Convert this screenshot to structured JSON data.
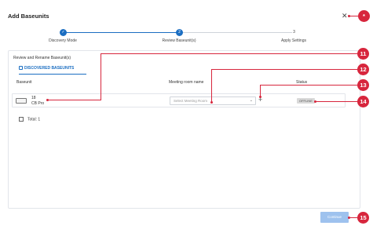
{
  "dialog": {
    "title": "Add Baseunits",
    "close_label": "✕"
  },
  "stepper": {
    "steps": [
      {
        "number": "",
        "label": "Discovery Mode",
        "status": "completed"
      },
      {
        "number": "2",
        "label": "Review Baseunit(s)",
        "status": "active"
      },
      {
        "number": "3",
        "label": "Apply Settings",
        "status": "pending"
      }
    ]
  },
  "panel": {
    "title": "Review and Rename Baseunit(s)",
    "tab_label": "DISCOVERED BASEUNITS",
    "columns": {
      "baseunit": "Baseunit",
      "room": "Meeting room name",
      "status": "Status"
    },
    "row": {
      "id": "18",
      "model": "CB Pro",
      "room_placeholder": "Select Meeting Room",
      "add_label": "+",
      "status": "OFFLINE"
    },
    "total": "Total: 1"
  },
  "footer": {
    "continue_label": "Continue"
  },
  "callouts": {
    "close": "*",
    "baseunit": "11",
    "room": "12",
    "add": "13",
    "status": "14",
    "continue": "15"
  },
  "colors": {
    "accent": "#1b6ec2",
    "callout": "#d7263d",
    "continue_disabled": "#9ec2ee",
    "badge": "#d9d9d9"
  }
}
